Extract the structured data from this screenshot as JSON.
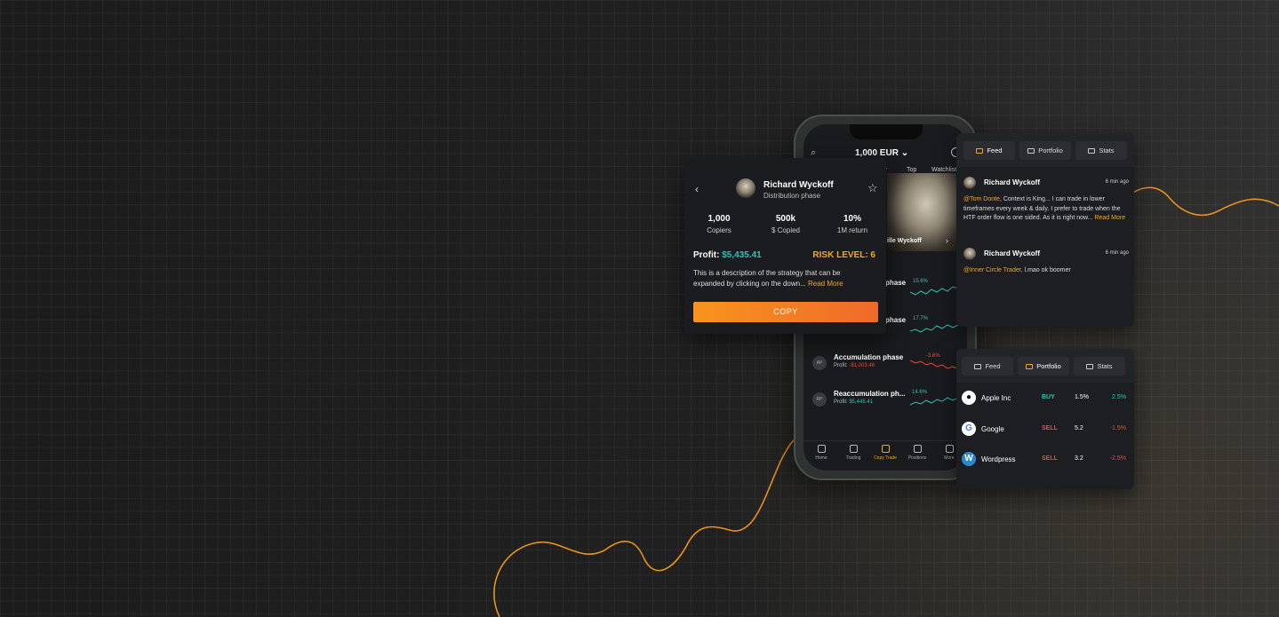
{
  "phone": {
    "balance": "1,000 EUR ⌄",
    "tabs": [
      "ar",
      "Top",
      "Watchlist"
    ],
    "strategies": [
      {
        "initials": "",
        "name": "phase",
        "profit_label": "",
        "profit": "",
        "change": "15.6%",
        "trend": "up"
      },
      {
        "initials": "",
        "name": "phase",
        "profit_label": "",
        "profit": "",
        "change": "17.7%",
        "trend": "up"
      },
      {
        "initials": "AP",
        "name": "Accumulation phase",
        "profit_label": "Profit:",
        "profit": "-$1,003.46",
        "change": "-3.6%",
        "trend": "down"
      },
      {
        "initials": "RP",
        "name": "Reaccumulation ph...",
        "profit_label": "Profit:",
        "profit": "$5,445.41",
        "change": "14.6%",
        "trend": "up"
      }
    ],
    "portrait_name": "ille Wyckoff",
    "nav": [
      "Home",
      "Trading",
      "Copy Trade",
      "Positions",
      "More"
    ]
  },
  "detail": {
    "name": "Richard Wyckoff",
    "subtitle": "Distribution phase",
    "stats": [
      {
        "value": "1,000",
        "label": "Copiers"
      },
      {
        "value": "500k",
        "label": "$ Copied"
      },
      {
        "value": "10%",
        "label": "1M return"
      }
    ],
    "profit_label": "Profit:",
    "profit_value": "$5,435.41",
    "risk": "RISK LEVEL: 6",
    "description": "This is a description of the strategy that can be expanded by clicking on the down...",
    "read_more": "Read More",
    "copy_label": "COPY"
  },
  "feed_card": {
    "tabs": [
      "Feed",
      "Portfolio",
      "Stats"
    ],
    "active_tab": "Feed",
    "posts": [
      {
        "author": "Richard Wyckoff",
        "time": "6 min ago",
        "mention": "@Tom Donte,",
        "text": " Context is King... I can trade in lower timeframes every week & daily. I prefer to trade when the HTF order flow is one sided.  As it is right now...",
        "read_more": "Read More"
      },
      {
        "author": "Richard Wyckoff",
        "time": "6 min ago",
        "mention": "@Inner Circle Trader,",
        "text": " l.mao ok boomer",
        "read_more": ""
      }
    ]
  },
  "portfolio_card": {
    "tabs": [
      "Feed",
      "Portfolio",
      "Stats"
    ],
    "active_tab": "Portfolio",
    "holdings": [
      {
        "logo": "apple-icon",
        "name": "Apple Inc",
        "action": "BUY",
        "qty": "1.5%",
        "ret": "2.5%"
      },
      {
        "logo": "google-icon",
        "name": "Google",
        "action": "SELL",
        "qty": "5.2",
        "ret": "-1.5%"
      },
      {
        "logo": "wordpress-icon",
        "name": "Wordpress",
        "action": "SELL",
        "qty": "3.2",
        "ret": "-2.5%"
      }
    ]
  },
  "colors": {
    "accent": "#f5a623",
    "up": "#2ec4b6",
    "down": "#ef4b3b",
    "background": "#1e1e1e"
  }
}
